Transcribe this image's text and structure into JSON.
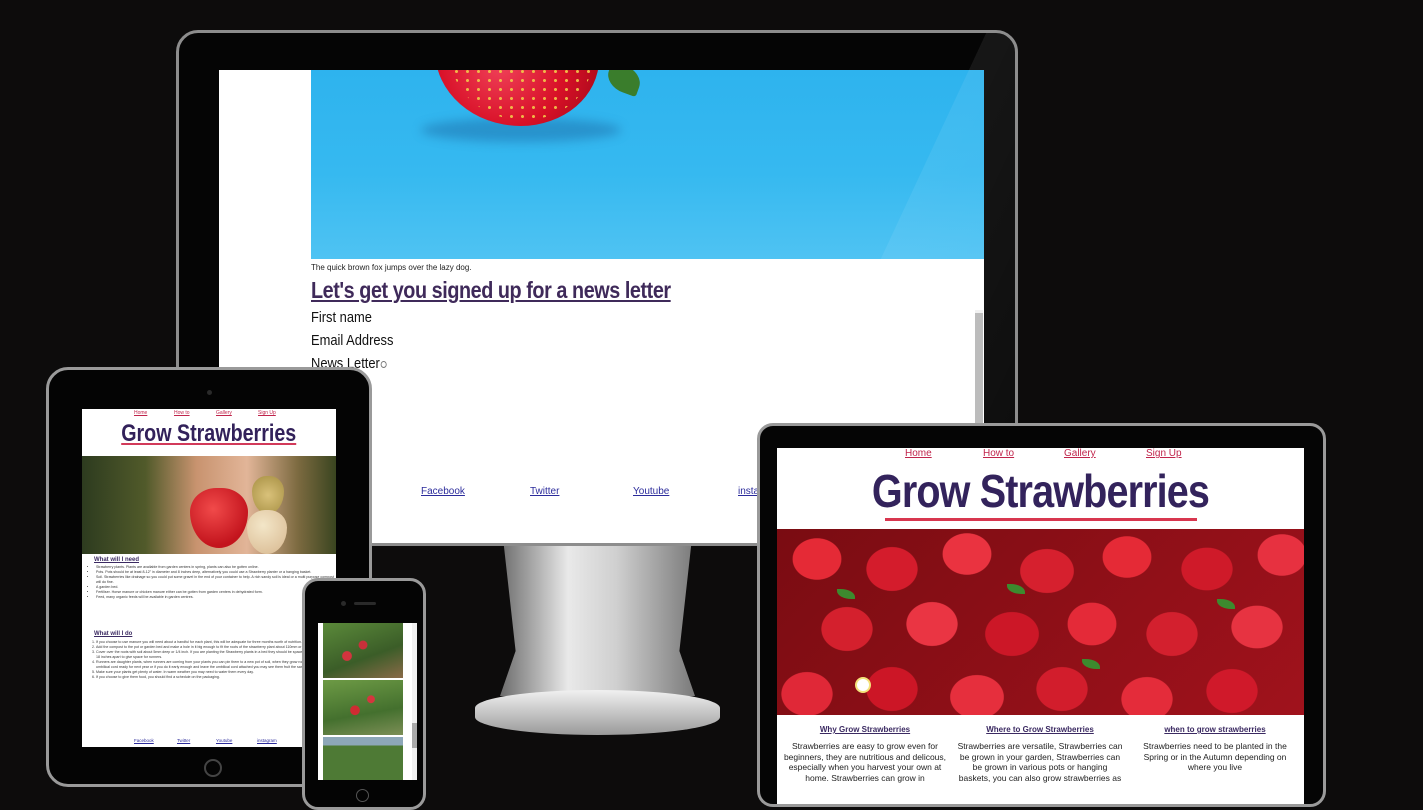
{
  "desktop": {
    "hero_caption": "The quick brown fox jumps over the lazy dog.",
    "newsletter": {
      "heading": "Let's get you signed up for a news letter",
      "first_name_label": "First name",
      "email_label": "Email Address",
      "newsletter_label": "News Letter"
    },
    "footer_links": [
      "Facebook",
      "Twitter",
      "Youtube",
      "instag"
    ]
  },
  "tablet": {
    "nav": [
      "Home",
      "How to",
      "Gallery",
      "Sign Up"
    ],
    "title": "Grow Strawberries",
    "need_heading": "What will I need",
    "need_items": [
      "Strawberry plants. Plants are available from garden centers in spring, plants can also be gotten online.",
      "Pots. Pots should be at least 8-12\" in diameter and 8 inches deep, alternatively you could use a Strawberry planter or a hanging basket.",
      "Soil. Strawberries like drainage so you could put some gravel in the end of your container to help. A rich sandy soil is ideal or a multi purpose compost will do fine.",
      "A garden bed.",
      "Fertiliser. Horse manure or chicken manure either can be gotten from garden centers in dehydrated form.",
      "Feed, many organic feeds will be available in garden centres."
    ],
    "do_heading": "What will I do",
    "do_items": [
      "If you choose to use manure you will need about a handful for each plant, this will be adequate for three months worth of nutrition.",
      "Add the compost to the pot or garden bed and make a hole in it big enough to fit the roots of the strawberry plant about 110mm or 5 to 6 inches deep.",
      "Cover over the roots with soil about 5mm deep or 1/4 inch. If you are planting the Strawberry plants in a bed they should be spaced about 450mm or 18 inches apart to give space for runners.",
      "Runners are daughter plants, when runners are coming from your plants you can pin them to a new pot of soil, when they grow roots you can cut the umbilical cord ready for next year or if you do it early enough and leave the umbilical cord attached you may see them fruit the same year.",
      "Make sure your plants get plenty of water. In warm weather you may need to water them every day.",
      "If you choose to give them food, you should find a schedule on the packaging."
    ],
    "footer_links": [
      "Facebook",
      "Twitter",
      "Youtube",
      "instagram"
    ]
  },
  "laptop": {
    "nav": [
      "Home",
      "How to",
      "Gallery",
      "Sign Up"
    ],
    "title": "Grow Strawberries",
    "columns": [
      {
        "heading": "Why Grow Strawberries",
        "text": "Strawberries are easy to grow even for beginners, they are nutritious and delicous, especially when you harvest your own at home. Strawberries can grow in"
      },
      {
        "heading": "Where to Grow Strawberries",
        "text": "Strawberries are versatile, Strawberries can be grown in your garden, Strawberries can be grown in various pots or hanging baskets, you can also grow strawberries as"
      },
      {
        "heading": "when to grow strawberries",
        "text": "Strawberries need to be planted in the Spring or in the Autumn depending on where you live"
      }
    ]
  },
  "colors": {
    "background": "#0d0c0c",
    "title_purple": "#33235c",
    "nav_pink": "#c0244b",
    "hero_blue": "#36b9f0",
    "link_blue": "#2b2b9b"
  }
}
